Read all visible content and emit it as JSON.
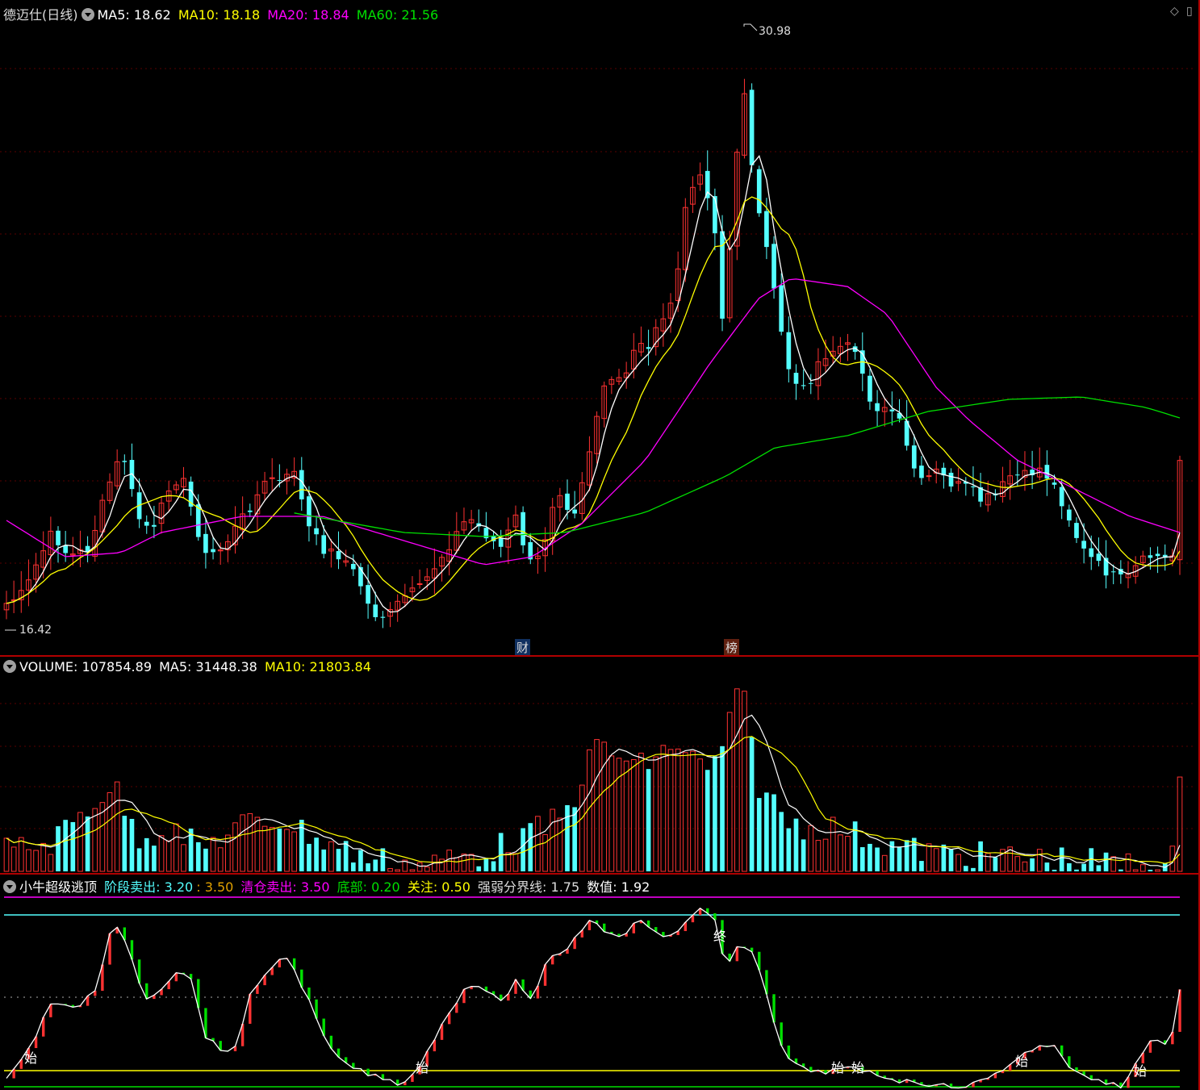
{
  "price_panel": {
    "stock_name": "德迈仕(日线)",
    "ma5_label": "MA5: 18.62",
    "ma10_label": "MA10: 18.18",
    "ma20_label": "MA20: 18.84",
    "ma60_label": "MA60: 21.56",
    "high_label": "30.98",
    "low_label": "16.42",
    "tag_finance": "财",
    "tag_list": "榜",
    "colors": {
      "up": "#ff3232",
      "down": "#54ffff",
      "ma5": "#ffffff",
      "ma10": "#ffff00",
      "ma20": "#ff00ff",
      "ma60": "#00e000"
    }
  },
  "volume_panel": {
    "volume_label": "VOLUME: 107854.89",
    "ma5_label": "MA5: 31448.38",
    "ma10_label": "MA10: 21803.84"
  },
  "indicator_panel": {
    "name": "小牛超级逃顶",
    "stage_sell_label": "阶段卖出: 3.20",
    "stage_sell_value2": ": 3.50",
    "clear_sell_label": "清仓卖出: 3.50",
    "bottom_label": "底部: 0.20",
    "focus_label": "关注: 0.50",
    "strength_label": "强弱分界线: 1.75",
    "value_label": "数值: 1.92",
    "signal_start": "始",
    "signal_end": "终"
  },
  "window_icons": [
    "diamond-icon",
    "restore-icon"
  ],
  "chart_data": {
    "type": "candlestick",
    "price_range": [
      16.42,
      30.98
    ],
    "volume_max": 107854.89,
    "indicator_range": [
      0,
      3.5
    ]
  }
}
